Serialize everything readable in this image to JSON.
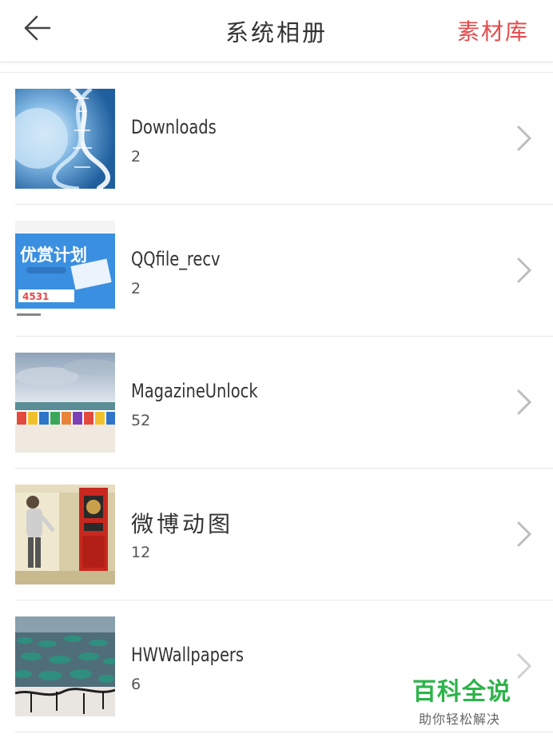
{
  "header": {
    "title": "系统相册",
    "right_action": "素材库",
    "accent_color": "#e34b4b"
  },
  "albums": [
    {
      "name": "Downloads",
      "count": "2",
      "thumb": "dna-helix-image"
    },
    {
      "name": "QQfile_recv",
      "count": "2",
      "thumb": "promo-banner-image"
    },
    {
      "name": "MagazineUnlock",
      "count": "52",
      "thumb": "beach-huts-image"
    },
    {
      "name": "微博动图",
      "count": "12",
      "thumb": "arcade-player-image"
    },
    {
      "name": "HWWallpapers",
      "count": "6",
      "thumb": "lily-pond-image"
    }
  ],
  "thumb_text": {
    "promo_top": "优赏计划",
    "promo_number": "4531"
  },
  "watermark": {
    "main": "百科全说",
    "sub": "助你轻松解决",
    "color": "#2db34a"
  }
}
